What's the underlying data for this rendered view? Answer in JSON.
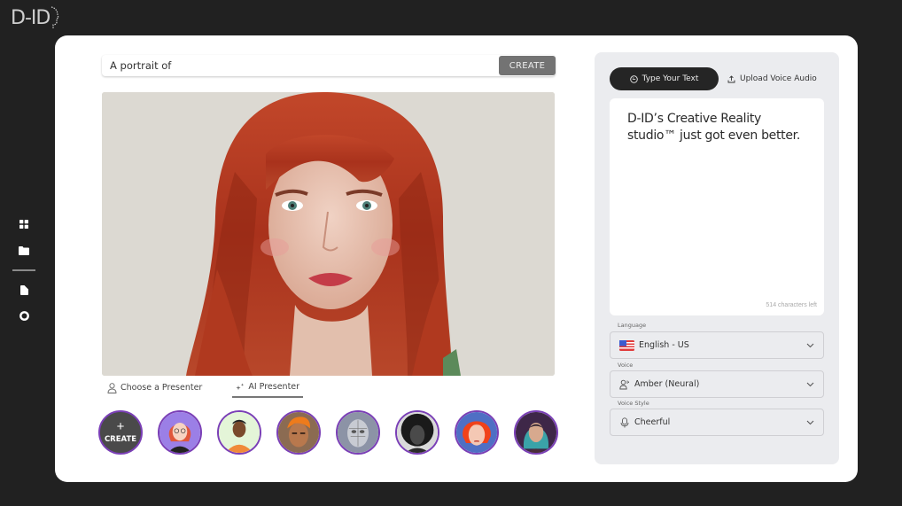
{
  "brand": {
    "logo_text": "D-ID"
  },
  "side_nav": {
    "items": [
      {
        "name": "dashboard",
        "icon": "grid-icon"
      },
      {
        "name": "library",
        "icon": "folder-icon"
      },
      {
        "name": "documents",
        "icon": "document-icon"
      },
      {
        "name": "help",
        "icon": "lifebuoy-icon"
      }
    ]
  },
  "prompt": {
    "value": "A portrait of",
    "create_label": "CREATE"
  },
  "presenter_tabs": [
    {
      "label": "Choose a Presenter",
      "icon": "person-icon",
      "active": false
    },
    {
      "label": "AI Presenter",
      "icon": "sparkle-icon",
      "active": true
    }
  ],
  "avatars": {
    "create_label": "CREATE",
    "items": [
      {
        "name": "cartoon-woman-red-hair"
      },
      {
        "name": "cartoon-man-orange-shirt"
      },
      {
        "name": "man-orange-hair"
      },
      {
        "name": "robot-face"
      },
      {
        "name": "woman-black-and-white"
      },
      {
        "name": "woman-red-hair-stylized"
      },
      {
        "name": "woman-teal-hair"
      }
    ]
  },
  "panel": {
    "modes": [
      {
        "label": "Type Your Text",
        "icon": "text-icon",
        "active": true
      },
      {
        "label": "Upload Voice Audio",
        "icon": "upload-icon",
        "active": false
      }
    ],
    "script_text": "D-ID’s Creative Reality studio™ just got even better.",
    "characters_left": "514 characters left",
    "language": {
      "label": "Language",
      "value": "English - US",
      "icon": "us-flag-icon"
    },
    "voice": {
      "label": "Voice",
      "value": "Amber (Neural)",
      "icon": "voice-person-icon"
    },
    "voice_style": {
      "label": "Voice Style",
      "value": "Cheerful",
      "icon": "microphone-icon"
    }
  },
  "colors": {
    "background": "#212121",
    "card": "#ffffff",
    "panel": "#ebecef",
    "avatar_ring": "#7a3fb6",
    "create_button": "#737373"
  }
}
